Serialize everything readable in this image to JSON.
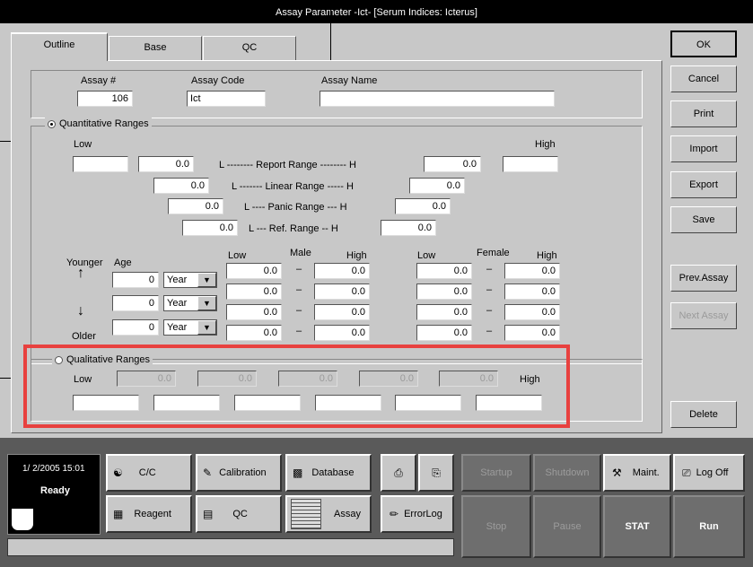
{
  "window": {
    "title": "Assay Parameter -Ict- [Serum Indices: Icterus]"
  },
  "tabs": [
    "Outline",
    "Base",
    "QC"
  ],
  "assay": {
    "number_label": "Assay #",
    "number_value": "106",
    "code_label": "Assay Code",
    "code_value": "Ict",
    "name_label": "Assay Name",
    "name_value": ""
  },
  "quant": {
    "title": "Quantitative Ranges",
    "low_label": "Low",
    "high_label": "High",
    "report": {
      "label": "L -------- Report Range -------- H",
      "low": "",
      "low2": "0.0",
      "high": "0.0",
      "high2": ""
    },
    "linear": {
      "label": "L ------- Linear Range ----- H",
      "low": "0.0",
      "high": "0.0"
    },
    "panic": {
      "label": "L ---- Panic Range  --- H",
      "low": "0.0",
      "high": "0.0"
    },
    "ref": {
      "label": "L --- Ref. Range   -- H",
      "low": "0.0",
      "high": "0.0"
    },
    "younger": "Younger",
    "older": "Older",
    "age_label": "Age",
    "male_label": "Male",
    "female_label": "Female",
    "col_low": "Low",
    "col_high": "High",
    "dash": "–",
    "ages": [
      {
        "age": "0",
        "unit": "Year"
      },
      {
        "age": "0",
        "unit": "Year"
      },
      {
        "age": "0",
        "unit": "Year"
      }
    ],
    "rows": [
      {
        "ml": "0.0",
        "mh": "0.0",
        "fl": "0.0",
        "fh": "0.0"
      },
      {
        "ml": "0.0",
        "mh": "0.0",
        "fl": "0.0",
        "fh": "0.0"
      },
      {
        "ml": "0.0",
        "mh": "0.0",
        "fl": "0.0",
        "fh": "0.0"
      },
      {
        "ml": "0.0",
        "mh": "0.0",
        "fl": "0.0",
        "fh": "0.0"
      }
    ]
  },
  "qual": {
    "title": "Qualitative Ranges",
    "low_label": "Low",
    "high_label": "High",
    "thresholds": [
      "0.0",
      "0.0",
      "0.0",
      "0.0",
      "0.0"
    ],
    "names": [
      "",
      "",
      "",
      "",
      "",
      ""
    ]
  },
  "side_buttons": {
    "ok": "OK",
    "cancel": "Cancel",
    "print": "Print",
    "import": "Import",
    "export": "Export",
    "save": "Save",
    "prev": "Prev.Assay",
    "next": "Next Assay",
    "delete": "Delete"
  },
  "status": {
    "datetime": "1/  2/2005 15:01",
    "state": "Ready"
  },
  "nav": {
    "cc": "C/C",
    "calibration": "Calibration",
    "database": "Database",
    "reagent": "Reagent",
    "qc": "QC",
    "assay": "Assay",
    "errorlog": "ErrorLog",
    "startup": "Startup",
    "shutdown": "Shutdown",
    "maint": "Maint.",
    "logoff": "Log Off",
    "stop": "Stop",
    "pause": "Pause",
    "stat": "STAT",
    "run": "Run"
  }
}
